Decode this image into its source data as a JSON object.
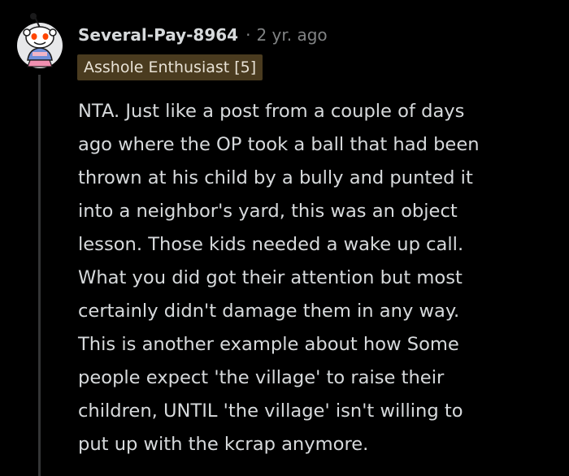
{
  "comment": {
    "username": "Several-Pay-8964",
    "separator": "·",
    "time": "2 yr. ago",
    "flair": "Asshole Enthusiast [5]",
    "avatar_icon": "snoo-avatar-icon",
    "body_lines": [
      "NTA. Just like a post from a couple of days",
      "ago where the OP took a ball that had been",
      "thrown at his child by a bully and punted it",
      "into a neighbor's yard, this was an object",
      "lesson. Those kids needed a wake up call.",
      "What you did got their attention but most",
      "certainly didn't damage them in any way.",
      "This is another example about how Some",
      "people expect 'the village' to raise their",
      "children, UNTIL 'the village' isn't willing to",
      "put up with the kcrap anymore."
    ]
  },
  "colors": {
    "background": "#000000",
    "text": "#d7dadc",
    "meta": "#818384",
    "flair_bg": "#4a3b1f",
    "thread_line": "#343536"
  }
}
